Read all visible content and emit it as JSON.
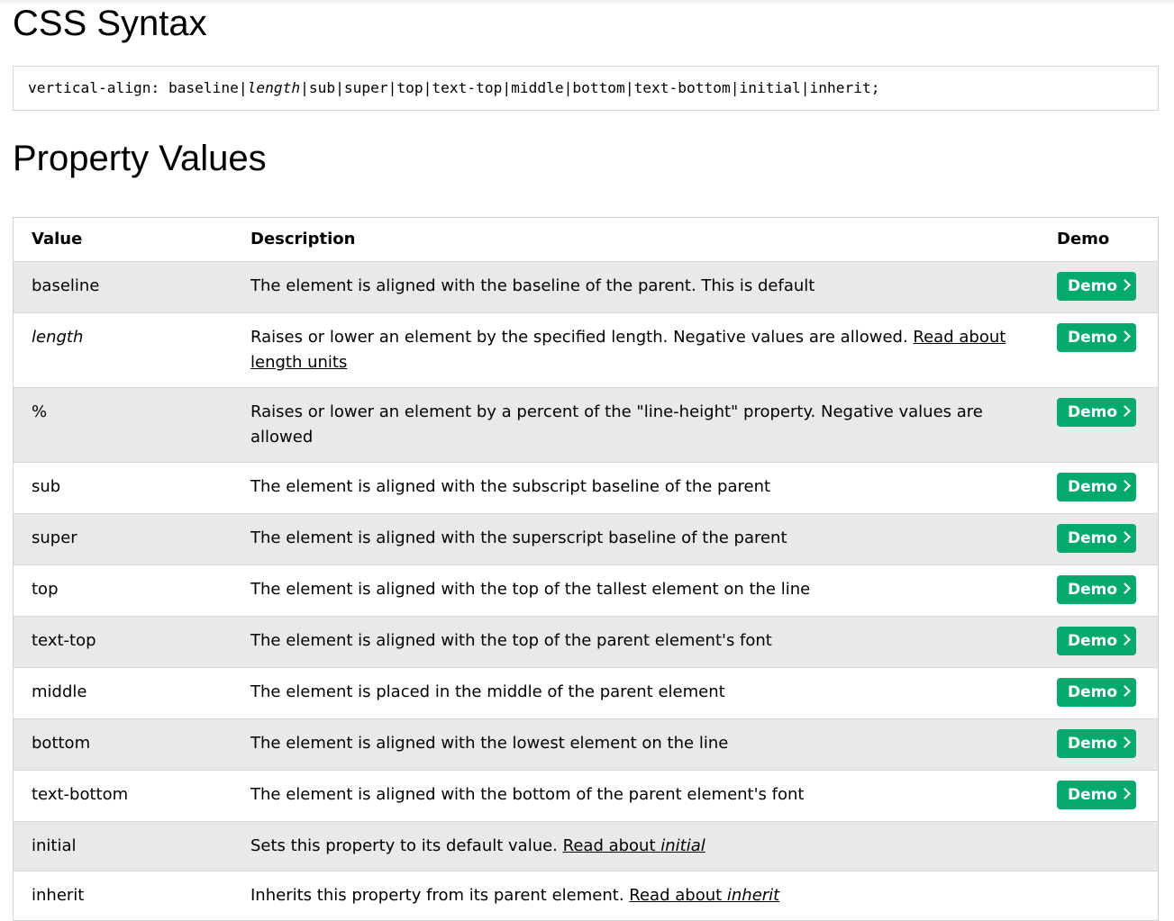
{
  "syntax": {
    "heading": "CSS Syntax",
    "prefix": "vertical-align: ",
    "values": [
      "baseline",
      "length",
      "sub",
      "super",
      "top",
      "text-top",
      "middle",
      "bottom",
      "text-bottom",
      "initial",
      "inherit"
    ],
    "suffix": ";"
  },
  "values_heading": "Property Values",
  "table": {
    "headers": {
      "value": "Value",
      "description": "Description",
      "demo": "Demo"
    },
    "demo_label": "Demo",
    "rows": [
      {
        "value": "baseline",
        "description": "The element is aligned with the baseline of the parent. This is default",
        "link": "",
        "link_em": "",
        "demo": true
      },
      {
        "value": "length",
        "italic": true,
        "description": "Raises or lower an element by the specified length. Negative values are allowed.",
        "link": "Read about length units",
        "link_em": "",
        "demo": true
      },
      {
        "value": "%",
        "description": "Raises or lower an element by a percent of the \"line-height\" property. Negative values are allowed",
        "link": "",
        "link_em": "",
        "demo": true
      },
      {
        "value": "sub",
        "description": "The element is aligned with the subscript baseline of the parent",
        "link": "",
        "link_em": "",
        "demo": true
      },
      {
        "value": "super",
        "description": "The element is aligned with the superscript baseline of the parent",
        "link": "",
        "link_em": "",
        "demo": true
      },
      {
        "value": "top",
        "description": "The element is aligned with the top of the tallest element on the line",
        "link": "",
        "link_em": "",
        "demo": true
      },
      {
        "value": "text-top",
        "description": "The element is aligned with the top of the parent element's font",
        "link": "",
        "link_em": "",
        "demo": true
      },
      {
        "value": "middle",
        "description": "The element is placed in the middle of the parent element",
        "link": "",
        "link_em": "",
        "demo": true
      },
      {
        "value": "bottom",
        "description": "The element is aligned with the lowest element on the line",
        "link": "",
        "link_em": "",
        "demo": true
      },
      {
        "value": "text-bottom",
        "description": "The element is aligned with the bottom of the parent element's font",
        "link": "",
        "link_em": "",
        "demo": true
      },
      {
        "value": "initial",
        "description": "Sets this property to its default value.",
        "link": "Read about ",
        "link_em": "initial",
        "demo": false
      },
      {
        "value": "inherit",
        "description": "Inherits this property from its parent element.",
        "link": "Read about ",
        "link_em": "inherit",
        "demo": false
      }
    ]
  },
  "colors": {
    "demo_button": "#04aa6d",
    "row_shade": "#e7e9eb",
    "border": "#d6d6d6"
  },
  "icons": {
    "demo_arrow": "chevron-right-icon"
  }
}
